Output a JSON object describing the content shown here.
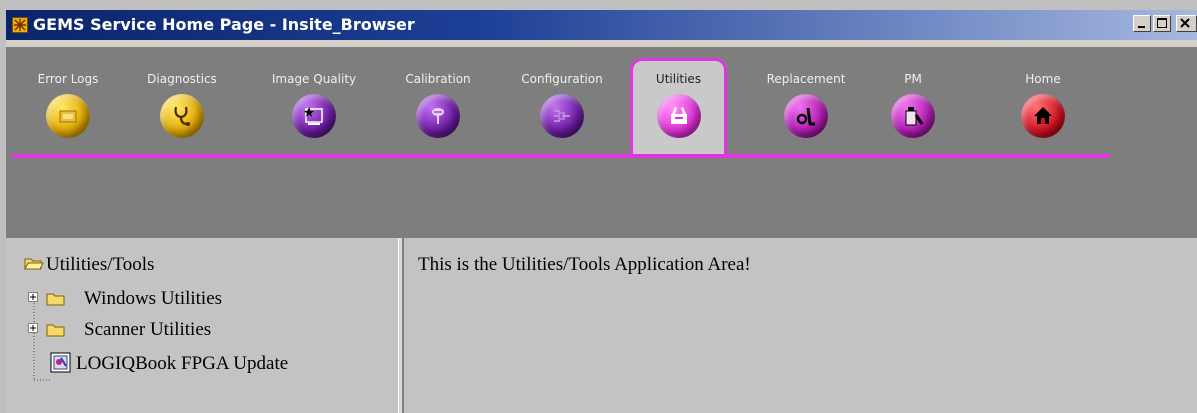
{
  "window": {
    "title": "GEMS Service Home Page - Insite_Browser",
    "controls": [
      "minimize",
      "maximize",
      "close"
    ]
  },
  "tabs": [
    {
      "label": "Error Logs",
      "icon": "error-log-icon",
      "color": "#f0c000"
    },
    {
      "label": "Diagnostics",
      "icon": "stethoscope-icon",
      "color": "#f0c000"
    },
    {
      "label": "Image Quality",
      "icon": "image-quality-icon",
      "color": "#7a1ea8"
    },
    {
      "label": "Calibration",
      "icon": "calibration-icon",
      "color": "#7a1ea8"
    },
    {
      "label": "Configuration",
      "icon": "configuration-icon",
      "color": "#7a1ea8"
    },
    {
      "label": "Utilities",
      "icon": "utilities-icon",
      "color": "#e030d8",
      "active": true
    },
    {
      "label": "Replacement",
      "icon": "replacement-icon",
      "color": "#b01ab0"
    },
    {
      "label": "PM",
      "icon": "pm-icon",
      "color": "#b01ab0"
    },
    {
      "label": "Home",
      "icon": "home-icon",
      "color": "#d01020"
    }
  ],
  "tree": {
    "root": "Utilities/Tools",
    "children": [
      {
        "label": "Windows Utilities",
        "type": "folder",
        "expandable": true
      },
      {
        "label": "Scanner Utilities",
        "type": "folder",
        "expandable": true
      },
      {
        "label": "LOGIQBook FPGA Update",
        "type": "application"
      }
    ]
  },
  "content": {
    "message": "This is the Utilities/Tools Application Area!"
  },
  "colors": {
    "accent": "#e234e0",
    "titlebar": "#0a246a"
  }
}
